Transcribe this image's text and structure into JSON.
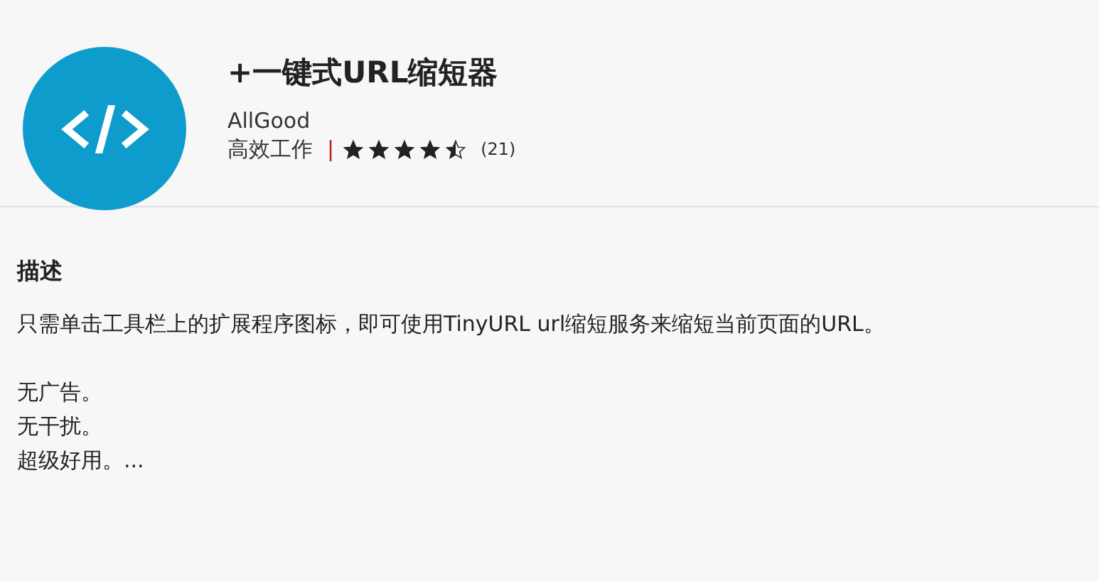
{
  "app": {
    "title": "+一键式URL缩短器",
    "publisher": "AllGood",
    "category": "高效工作",
    "separator": "|",
    "stars": 4.5,
    "rating_count": "(21)"
  },
  "description": {
    "heading": "描述",
    "paragraphs": [
      "只需单击工具栏上的扩展程序图标，即可使用TinyURL url缩短服务来缩短当前页面的URL。"
    ],
    "lines": [
      "无广告。",
      "无干扰。",
      "超级好用。..."
    ]
  }
}
